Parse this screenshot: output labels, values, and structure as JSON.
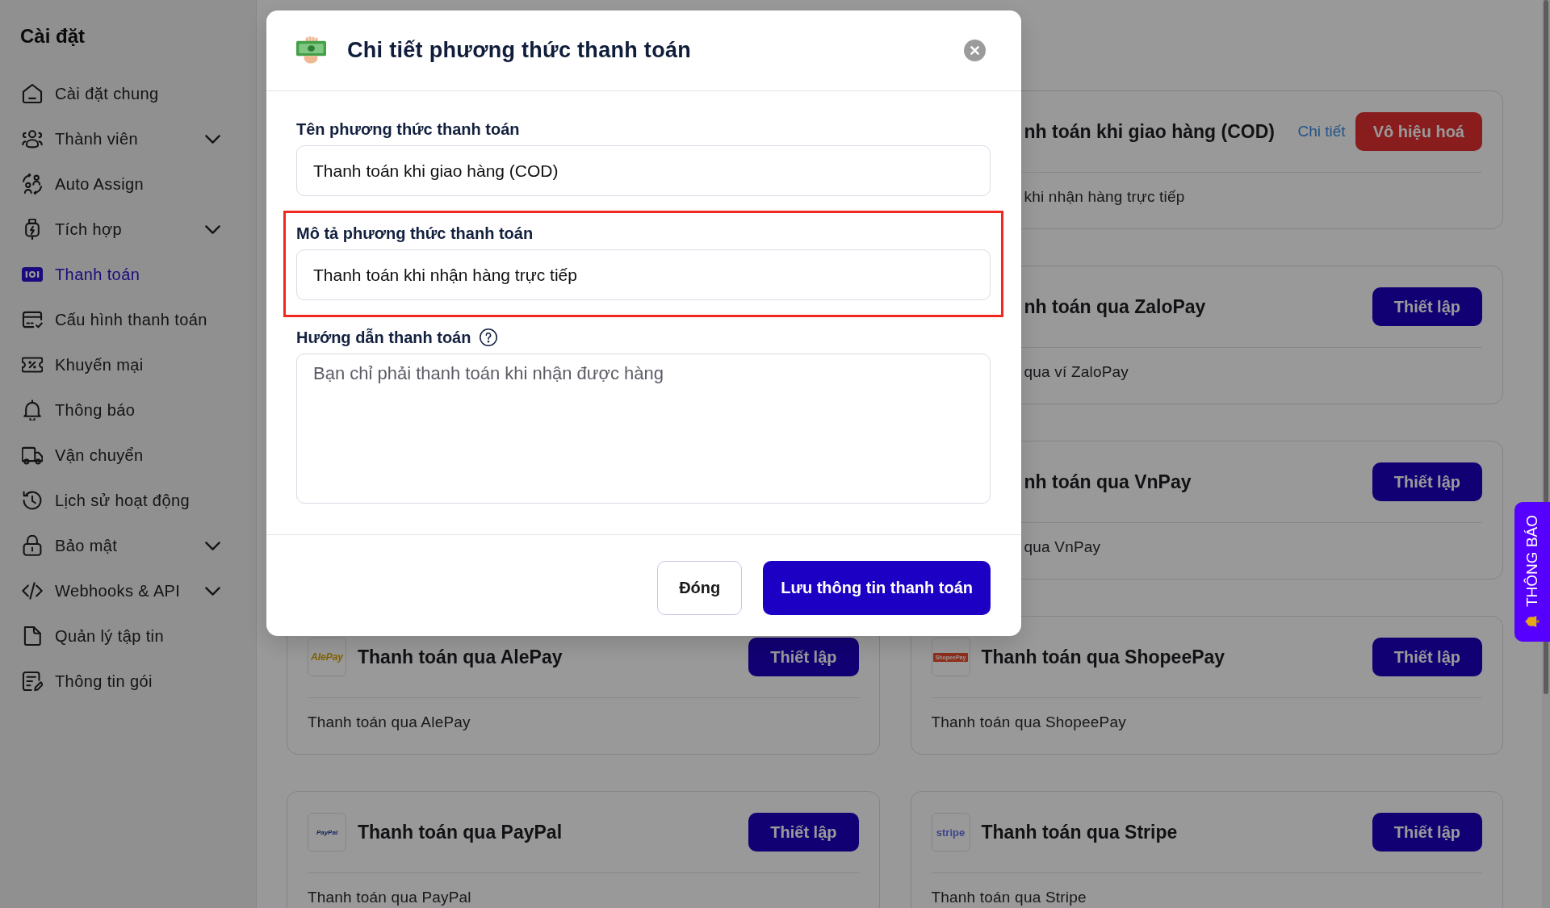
{
  "sidebar": {
    "title": "Cài đặt",
    "items": [
      {
        "label": "Cài đặt chung",
        "kind": "link",
        "selected": false
      },
      {
        "label": "Thành viên",
        "kind": "group",
        "expanded": false,
        "selected": false
      },
      {
        "label": "Auto Assign",
        "kind": "link",
        "selected": false
      },
      {
        "label": "Tích hợp",
        "kind": "group",
        "expanded": false,
        "selected": false
      },
      {
        "label": "Thanh toán",
        "kind": "link",
        "selected": true
      },
      {
        "label": "Cấu hình thanh toán",
        "kind": "link",
        "selected": false
      },
      {
        "label": "Khuyến mại",
        "kind": "link",
        "selected": false
      },
      {
        "label": "Thông báo",
        "kind": "link",
        "selected": false
      },
      {
        "label": "Vận chuyển",
        "kind": "link",
        "selected": false
      },
      {
        "label": "Lịch sử hoạt động",
        "kind": "link",
        "selected": false
      },
      {
        "label": "Bảo mật",
        "kind": "group",
        "expanded": false,
        "selected": false
      },
      {
        "label": "Webhooks & API",
        "kind": "group",
        "expanded": false,
        "selected": false
      },
      {
        "label": "Quản lý tập tin",
        "kind": "link",
        "selected": false
      },
      {
        "label": "Thông tin gói",
        "kind": "link",
        "selected": false
      }
    ]
  },
  "payment_rows": [
    {
      "cells": [
        {
          "title": "nh toán khi giao hàng (COD)",
          "description": "khi nhận hàng trực tiếp",
          "actions": [
            {
              "kind": "link",
              "label": "Chi tiết"
            },
            {
              "kind": "danger",
              "label": "Vô hiệu hoá"
            }
          ]
        }
      ]
    },
    {
      "cells": [
        {
          "title": "nh toán qua ZaloPay",
          "description": "qua ví ZaloPay",
          "actions": [
            {
              "kind": "primary",
              "label": "Thiết lập"
            }
          ]
        }
      ]
    },
    {
      "cells": [
        {
          "title": "nh toán qua VnPay",
          "description": "qua VnPay",
          "actions": [
            {
              "kind": "primary",
              "label": "Thiết lập"
            }
          ]
        }
      ]
    },
    {
      "cells": [
        {
          "logo": {
            "kind": "alepay",
            "text": "AlePay"
          },
          "title": "Thanh toán qua AlePay",
          "description": "Thanh toán qua AlePay",
          "actions": [
            {
              "kind": "primary",
              "label": "Thiết lập"
            }
          ]
        },
        {
          "logo": {
            "kind": "shopeepay",
            "text": "ShopeePay"
          },
          "title": "Thanh toán qua ShopeePay",
          "description": "Thanh toán qua ShopeePay",
          "actions": [
            {
              "kind": "primary",
              "label": "Thiết lập"
            }
          ]
        }
      ]
    },
    {
      "cells": [
        {
          "logo": {
            "kind": "paypal",
            "text": "PayPal"
          },
          "title": "Thanh toán qua PayPal",
          "description": "Thanh toán qua PayPal",
          "actions": [
            {
              "kind": "primary",
              "label": "Thiết lập"
            }
          ]
        },
        {
          "logo": {
            "kind": "stripe",
            "text": "stripe"
          },
          "title": "Thanh toán qua Stripe",
          "description": "Thanh toán qua Stripe",
          "actions": [
            {
              "kind": "primary",
              "label": "Thiết lập"
            }
          ]
        }
      ]
    }
  ],
  "modal": {
    "title": "Chi tiết phương thức thanh toán",
    "fields": [
      {
        "kind": "input",
        "label": "Tên phương thức thanh toán",
        "value": "Thanh toán khi giao hàng (COD)",
        "help": false,
        "highlighted": false
      },
      {
        "kind": "input",
        "label": "Mô tả phương thức thanh toán",
        "value": "Thanh toán khi nhận hàng trực tiếp",
        "help": false,
        "highlighted": true
      },
      {
        "kind": "textarea",
        "label": "Hướng dẫn thanh toán",
        "placeholder": "Bạn chỉ phải thanh toán khi nhận được hàng",
        "help": true,
        "highlighted": false
      }
    ],
    "buttons": [
      {
        "kind": "secondary",
        "label": "Đóng"
      },
      {
        "kind": "primary",
        "label": "Lưu thông tin thanh toán"
      }
    ]
  },
  "notification_tab": {
    "label": "THÔNG BÁO"
  }
}
